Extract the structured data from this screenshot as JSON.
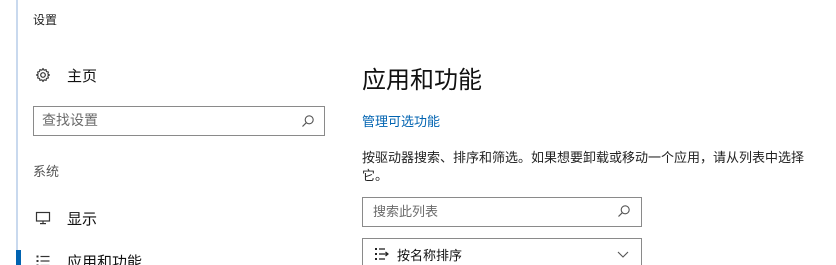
{
  "window": {
    "title": "设置"
  },
  "sidebar": {
    "home_label": "主页",
    "search_placeholder": "查找设置",
    "section_label": "系统",
    "items": [
      {
        "label": "显示",
        "icon": "monitor-icon"
      },
      {
        "label": "应用和功能",
        "icon": "list-icon",
        "active": true
      }
    ]
  },
  "main": {
    "title": "应用和功能",
    "link": "管理可选功能",
    "description": "按驱动器搜索、排序和筛选。如果想要卸载或移动一个应用，请从列表中选择它。",
    "search_placeholder": "搜索此列表",
    "sort_label": "按名称排序"
  },
  "colors": {
    "accent": "#0063b1",
    "border": "#8a8a8a"
  }
}
